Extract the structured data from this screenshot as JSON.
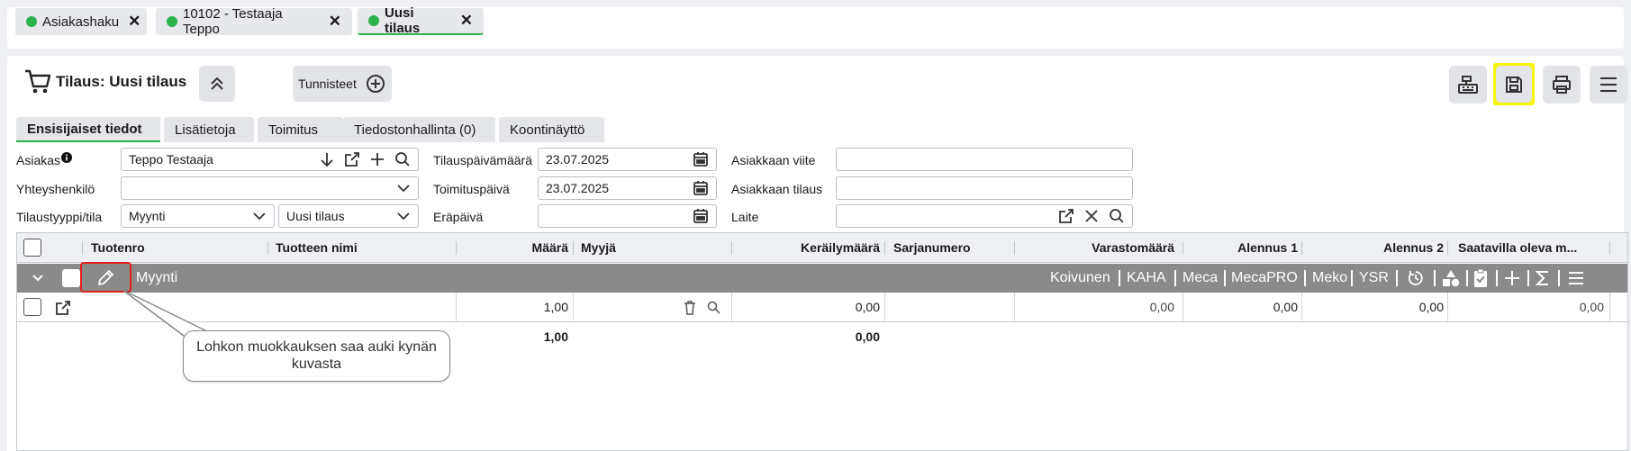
{
  "window_tabs": [
    {
      "label": "Asiakashaku",
      "active": false
    },
    {
      "label": "10102 - Testaaja Teppo",
      "active": false
    },
    {
      "label": "Uusi tilaus",
      "active": true
    }
  ],
  "header": {
    "title": "Tilaus: Uusi tilaus",
    "tags_button": "Tunnisteet"
  },
  "sub_tabs": [
    "Ensisijaiset tiedot",
    "Lisätietoja",
    "Toimitus",
    "Tiedostonhallinta (0)",
    "Koontinäyttö"
  ],
  "form": {
    "customer_label": "Asiakas",
    "customer_value": "Teppo Testaaja",
    "contact_label": "Yhteyshenkilö",
    "contact_value": "",
    "type_label": "Tilaustyyppi/tila",
    "type_value": "Myynti",
    "status_value": "Uusi tilaus",
    "order_date_label": "Tilauspäivämäärä",
    "order_date_value": "23.07.2025",
    "delivery_date_label": "Toimituspäivä",
    "delivery_date_value": "23.07.2025",
    "due_date_label": "Eräpäivä",
    "due_date_value": "",
    "customer_ref_label": "Asiakkaan viite",
    "customer_ref_value": "",
    "customer_order_label": "Asiakkaan tilaus",
    "customer_order_value": "",
    "device_label": "Laite",
    "device_value": ""
  },
  "table": {
    "columns": [
      "Tuotenro",
      "Tuotteen nimi",
      "Määrä",
      "Myyjä",
      "Keräilymäärä",
      "Sarjanumero",
      "Varastomäärä",
      "Alennus 1",
      "Alennus 2",
      "Saatavilla oleva m..."
    ],
    "group": {
      "label": "Myynti",
      "links": [
        "Koivunen",
        "KAHA",
        "Meca",
        "MecaPRO",
        "Meko",
        "YSR"
      ]
    },
    "row": {
      "maara": "1,00",
      "kerailymaara": "0,00",
      "varastomaara": "0,00",
      "alennus1": "0,00",
      "alennus2": "0,00",
      "saatavilla": "0,00"
    },
    "totals": {
      "maara": "1,00",
      "kerailymaara": "0,00"
    }
  },
  "callout": {
    "text": "Lohkon muokkauksen saa auki kynän kuvasta"
  },
  "colors": {
    "accent_green": "#2bb24c",
    "save_highlight": "#f4f40a",
    "callout_red": "#e0201b",
    "group_row": "#8a8a8a"
  }
}
